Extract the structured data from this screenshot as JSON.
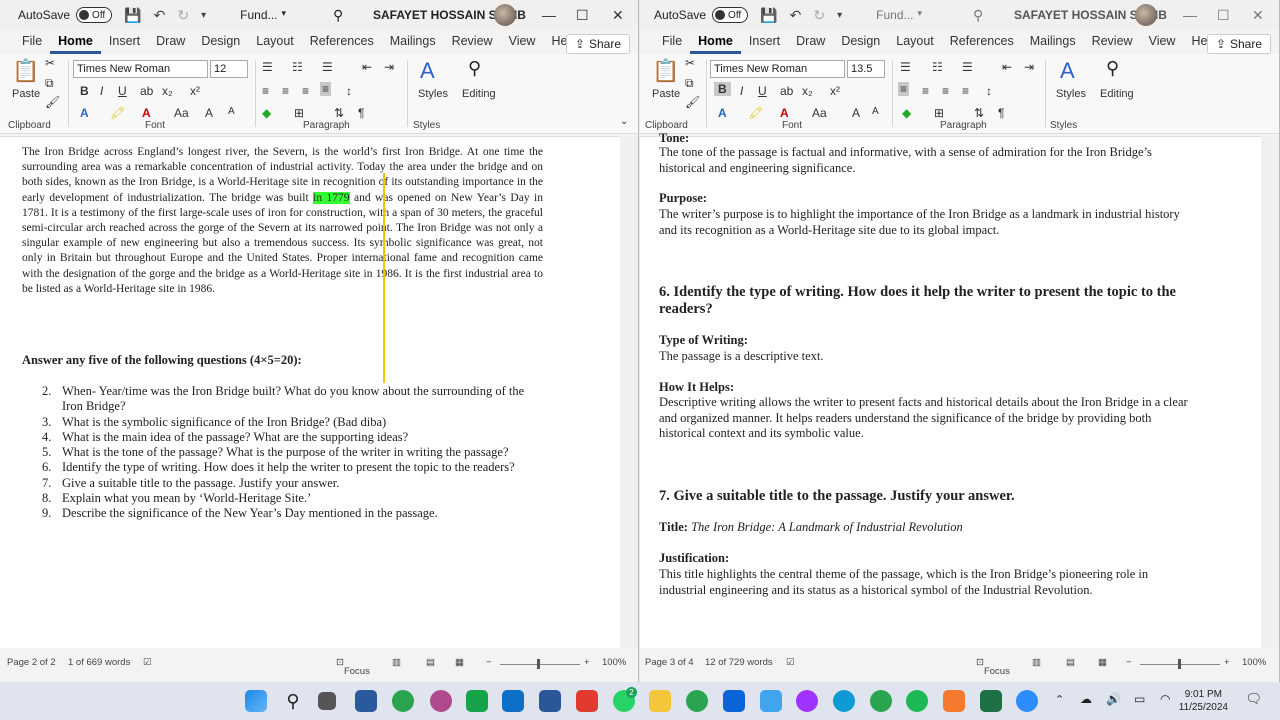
{
  "left": {
    "autosave": "AutoSave",
    "toggle": "Off",
    "docname": "Fund...",
    "user": "SAFAYET HOSSAIN SAKIB",
    "tabs": [
      "File",
      "Home",
      "Insert",
      "Draw",
      "Design",
      "Layout",
      "References",
      "Mailings",
      "Review",
      "View",
      "Help"
    ],
    "share": "Share",
    "font": "Times New Roman",
    "size": "12",
    "groups": {
      "clipboard": "Clipboard",
      "font": "Font",
      "paragraph": "Paragraph",
      "styles": "Styles",
      "paste": "Paste",
      "styles_btn": "Styles",
      "editing": "Editing"
    },
    "para1": "The Iron Bridge across England’s longest river, the Severn, is the world’s first Iron Bridge. At one time the surrounding area was a remarkable concentration of industrial activity. Today the area under the bridge and on both sides, known as the Iron Bridge, is a World-Heritage site in recognition of its outstanding importance in the early development of industrialization. The bridge was built",
    "para_hl": "in 1779",
    "para2": " and was opened on New Year’s Day in 1781. It is a testimony of the first large-scale uses of iron for construction, with a span of 30 meters, the graceful semi-circular arch reached across the gorge of the Severn at its narrowed point. The Iron Bridge was not only a singular example of new engineering but also a tremendous success. Its symbolic significance was great, not only in Britain but throughout Europe and the United States. Proper international fame and recognition came with the designation of the gorge and the bridge as a World-Heritage site in 1986. It is the first industrial area to be listed as a World-Heritage site in 1986.",
    "answer_heading": "Answer any five of the following questions (4×5=20):",
    "questions": [
      {
        "n": "2.",
        "t": "When- Year/time was the Iron Bridge built? What do you know about the surrounding of the Iron Bridge?"
      },
      {
        "n": "3.",
        "t": "What is the symbolic significance of the Iron Bridge? (Bad diba)"
      },
      {
        "n": "4.",
        "t": "What is the main idea of the passage? What are the supporting ideas?"
      },
      {
        "n": "5.",
        "t": "What is the tone of the passage? What is the purpose of the writer in writing the passage?"
      },
      {
        "n": "6.",
        "t": "Identify the type of writing. How does it help the writer to present the topic to the readers?"
      },
      {
        "n": "7.",
        "t": "Give a suitable title to the passage. Justify your answer."
      },
      {
        "n": "8.",
        "t": "Explain what you mean by ‘World-Heritage Site.’"
      },
      {
        "n": "9.",
        "t": "Describe the significance of the New Year’s Day mentioned in the passage."
      }
    ],
    "status": {
      "page": "Page 2 of 2",
      "words": "1 of 669 words",
      "focus": "Focus",
      "zoom": "100%"
    }
  },
  "right": {
    "autosave": "AutoSave",
    "toggle": "Off",
    "docname": "Fund...",
    "user": "SAFAYET HOSSAIN SAKIB",
    "tabs": [
      "File",
      "Home",
      "Insert",
      "Draw",
      "Design",
      "Layout",
      "References",
      "Mailings",
      "Review",
      "View",
      "Help"
    ],
    "share": "Share",
    "font": "Times New Roman",
    "size": "13.5",
    "groups": {
      "clipboard": "Clipboard",
      "font": "Font",
      "paragraph": "Paragraph",
      "styles": "Styles",
      "paste": "Paste",
      "styles_btn": "Styles",
      "editing": "Editing"
    },
    "tone_head": "Tone:",
    "tone": "The tone of the passage is factual and informative, with a sense of admiration for the Iron Bridge’s historical and engineering significance.",
    "purpose_head": "Purpose:",
    "purpose": "The writer’s purpose is to highlight the importance of the Iron Bridge as a landmark in industrial history and its recognition as a World-Heritage site due to its global impact.",
    "q6": "6. Identify the type of writing. How does it help the writer to present the topic to the readers?",
    "type_head": "Type of Writing:",
    "type": "The passage is a descriptive text.",
    "helps_head": "How It Helps:",
    "helps": "Descriptive writing allows the writer to present facts and historical details about the Iron Bridge in a clear and organized manner. It helps readers understand the significance of the bridge by providing both historical context and its symbolic value.",
    "q7": "7. Give a suitable title to the passage. Justify your answer.",
    "title_head": "Title:",
    "title": "The Iron Bridge: A Landmark of Industrial Revolution",
    "just_head": "Justification:",
    "just": "This title highlights the central theme of the passage, which is the Iron Bridge’s pioneering role in industrial engineering and its status as a historical symbol of the Industrial Revolution.",
    "status": {
      "page": "Page 3 of 4",
      "words": "12 of 729 words",
      "focus": "Focus",
      "zoom": "100%"
    }
  },
  "taskbar": {
    "time": "9:01 PM",
    "date": "11/25/2024",
    "whatsapp_badge": "2"
  }
}
